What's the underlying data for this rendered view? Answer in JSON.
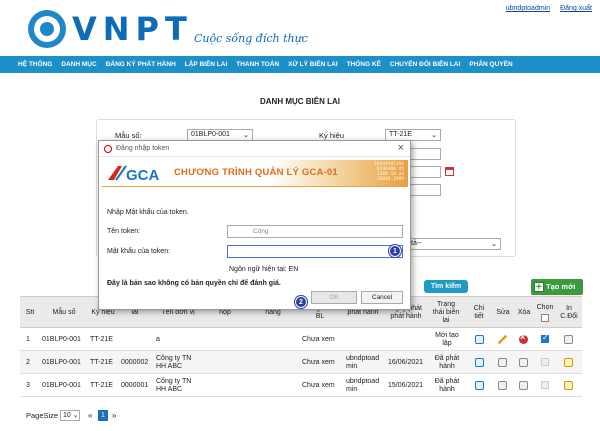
{
  "header": {
    "brand": "VNPT",
    "slogan": "Cuộc sống đích thực",
    "user_link": "ubndptoadmin",
    "logout_link": "Đăng xuất"
  },
  "nav": [
    "HỆ THỐNG",
    "DANH MỤC",
    "ĐĂNG KÝ PHÁT HÀNH",
    "LẬP BIÊN LAI",
    "THANH TOÁN",
    "XỬ LÝ BIÊN LAI",
    "THỐNG KÊ",
    "CHUYỂN ĐỔI BIÊN LAI",
    "PHÂN QUYỀN"
  ],
  "page_title": "DANH MỤC BIÊN LAI",
  "filter": {
    "mau_so_label": "Mẫu số:",
    "mau_so_value": "01BLP0-001",
    "ky_hieu_label": "Ký hiệu",
    "ky_hieu_value": "TT-21E",
    "status_select_value": "tả--"
  },
  "buttons": {
    "search": "Tìm kiếm",
    "create": "Tạo mới"
  },
  "table": {
    "headers": {
      "stt": "Stt",
      "mau_so": "Mẫu số",
      "ky_hieu": "Ký hiệu",
      "so_bien_lai": "lai",
      "ten_don_vi": "Tên đơn vị",
      "nop": "nộp",
      "hang": "hàng",
      "hang_xem_bl": "hàng xem BL",
      "phat_hanh": "phát hành",
      "ngay_phat_hanh": "phát hành",
      "ngay_phat_top": "Ngày phát",
      "trang_thai": "Trạng thái biên lai",
      "chi_tiet": "Chi tiết",
      "sua": "Sửa",
      "xoa": "Xóa",
      "chon": "Chọn",
      "in": "In C.Đổi"
    },
    "rows": [
      {
        "stt": "1",
        "mau_so": "01BLP0-001",
        "ky_hieu": "TT-21E",
        "so": "",
        "don_vi": "a",
        "xem": "Chưa xem",
        "nguoi": "",
        "ngay": "",
        "trang_thai": "Mới tạo lập"
      },
      {
        "stt": "2",
        "mau_so": "01BLP0-001",
        "ky_hieu": "TT-21E",
        "so": "0000002",
        "don_vi": "Công ty TN HH ABC",
        "xem": "Chưa xem",
        "nguoi": "ubndptoad min",
        "ngay": "16/06/2021",
        "trang_thai": "Đã phát hành"
      },
      {
        "stt": "3",
        "mau_so": "01BLP0-001",
        "ky_hieu": "TT-21E",
        "so": "0000001",
        "don_vi": "Công ty TN HH ABC",
        "xem": "Chưa xem",
        "nguoi": "ubndptoad min",
        "ngay": "15/06/2021",
        "trang_thai": "Đã phát hành"
      }
    ]
  },
  "pager": {
    "label": "PageSize",
    "size": "10",
    "prev": "«",
    "page": "1",
    "next": "»"
  },
  "dialog": {
    "title": "Đăng nhập token",
    "banner_brand": "GCA",
    "banner_title": "CHƯƠNG TRÌNH QUẢN LÝ GCA-01",
    "banner_digits": "10444905194\n0198488 45\n1209 19 24\n19848 1999",
    "prompt": "Nhập Mật khẩu của token.",
    "token_name_label": "Tên token:",
    "token_name_value": "Công",
    "password_label": "Mật khẩu của token:",
    "password_value": "",
    "language_text": "Ngôn ngữ hiện tại: EN",
    "warning": "Đây là bản sao không có bản quyền chỉ để đánh giá.",
    "ok": "OK",
    "cancel": "Cancel",
    "badge1": "1",
    "badge2": "2"
  }
}
